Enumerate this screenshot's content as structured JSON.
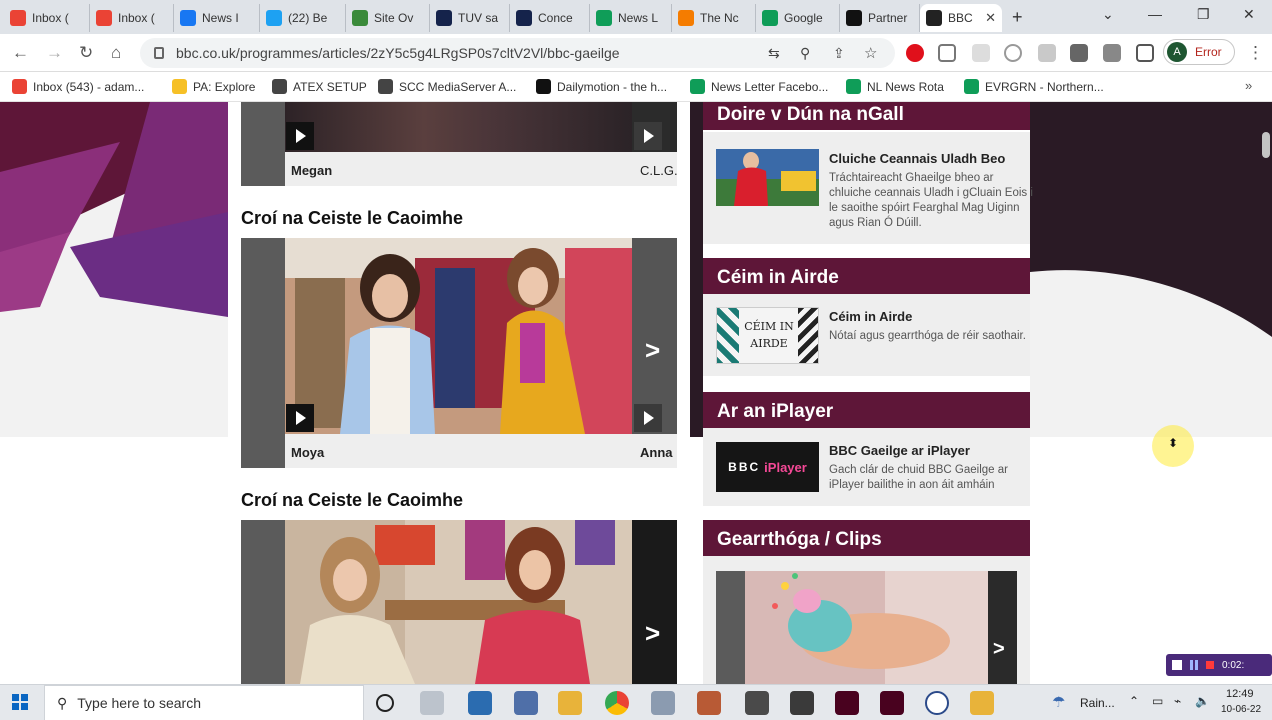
{
  "tabs": [
    {
      "label": "Inbox (",
      "icon": "gmail-icon",
      "color": "#ea4335"
    },
    {
      "label": "Inbox (",
      "icon": "gmail-icon",
      "color": "#ea4335"
    },
    {
      "label": "News I",
      "icon": "facebook-icon",
      "color": "#1877f2"
    },
    {
      "label": "(22) Be",
      "icon": "twitter-icon",
      "color": "#1da1f2"
    },
    {
      "label": "Site Ov",
      "icon": "tree-icon",
      "color": "#3a8a3a"
    },
    {
      "label": "TUV sa",
      "icon": "n-icon",
      "color": "#15234b"
    },
    {
      "label": "Conce",
      "icon": "n-icon",
      "color": "#15234b"
    },
    {
      "label": "News L",
      "icon": "sheets-icon",
      "color": "#0f9d58"
    },
    {
      "label": "The Nc",
      "icon": "chart-icon",
      "color": "#f57c00"
    },
    {
      "label": "Google",
      "icon": "hangouts-icon",
      "color": "#0f9d58"
    },
    {
      "label": "Partner",
      "icon": "dailymotion-icon",
      "color": "#111111"
    },
    {
      "label": "BBC",
      "icon": "bbc-icon",
      "color": "#222222"
    }
  ],
  "address": {
    "url": "bbc.co.uk/programmes/articles/2zY5c5g4LRgSP0s7cltV2Vl/bbc-gaeilge"
  },
  "profile": {
    "initial": "A",
    "status": "Error"
  },
  "bookmarks": [
    {
      "label": "Inbox (543) - adam...",
      "color": "#ea4335"
    },
    {
      "label": "PA: Explore",
      "color": "#f6c026"
    },
    {
      "label": "ATEX SETUP",
      "color": "#444444"
    },
    {
      "label": "SCC MediaServer A...",
      "color": "#444444"
    },
    {
      "label": "Dailymotion - the h...",
      "color": "#111111"
    },
    {
      "label": "News Letter Facebo...",
      "color": "#0f9d58"
    },
    {
      "label": "NL News Rota",
      "color": "#0f9d58"
    },
    {
      "label": "EVRGRN - Northern...",
      "color": "#0f9d58"
    }
  ],
  "content": {
    "top_card_caption": "Megan",
    "top_card_right_caption": "C.L.G.",
    "section1_title": "Croí na Ceiste le Caoimhe",
    "card1_caption": "Moya",
    "card1_right_caption": "Anna",
    "section2_title": "Croí na Ceiste le Caoimhe"
  },
  "panels": {
    "p1": {
      "title": "Doire v Dún na nGall",
      "item_title": "Cluiche Ceannais Uladh Beo",
      "item_desc": "Tráchtaireacht Ghaeilge bheo ar chluiche ceannais Uladh i gCluain Eois i le saoithe spóirt Fearghal Mag Uiginn agus Rian Ó Dúill."
    },
    "p2": {
      "title": "Céim in Airde",
      "item_title": "Céim in Airde",
      "item_desc": "Nótaí agus gearrthóga de réir saothair.",
      "thumb_text": "CÉIM IN AIRDE"
    },
    "p3": {
      "title": "Ar an iPlayer",
      "item_title": "BBC Gaeilge ar iPlayer",
      "item_desc": "Gach clár de chuid BBC Gaeilge ar iPlayer bailithe in aon áit amháin",
      "thumb_brand": "BBC",
      "thumb_word": "iPlayer"
    },
    "p4": {
      "title": "Gearrthóga / Clips"
    }
  },
  "taskbar": {
    "search_placeholder": "Type here to search",
    "weather": "Rain...",
    "time": "12:49",
    "date": "10-06-22",
    "recorder_time": "0:02:"
  },
  "colors": {
    "panel_header": "#5e1638",
    "accent": "#6d1d4c"
  }
}
